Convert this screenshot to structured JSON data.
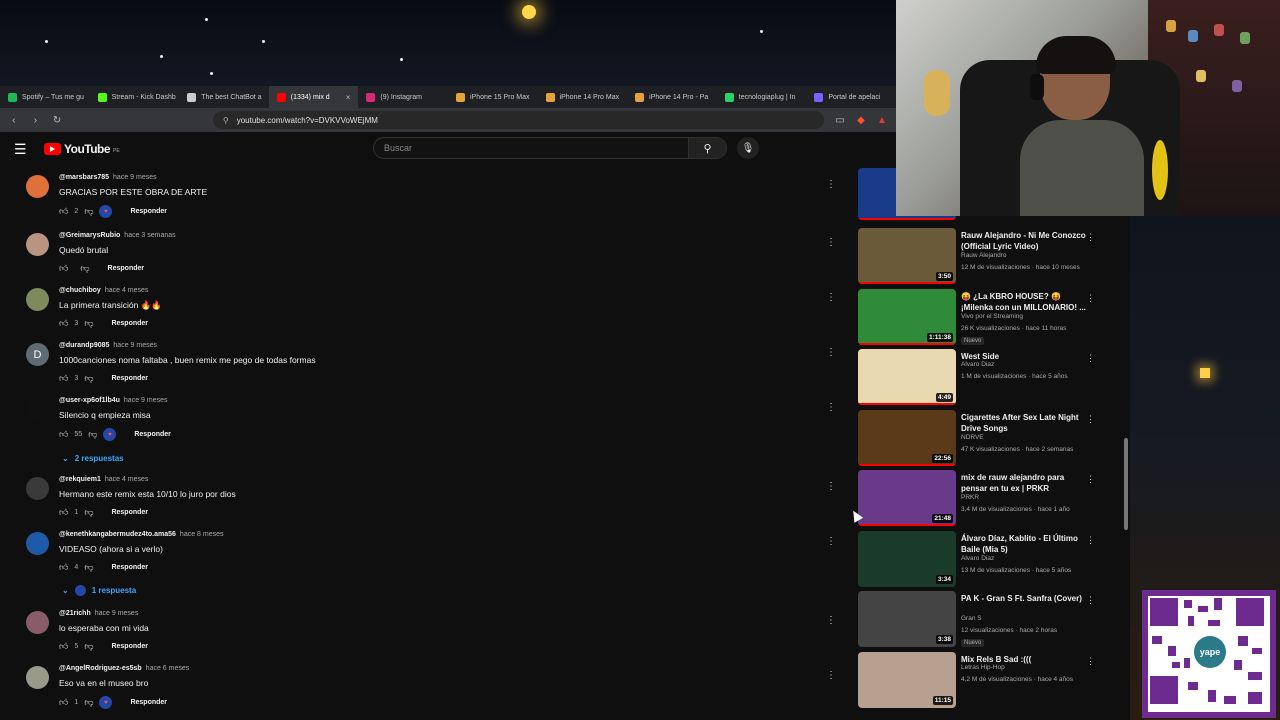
{
  "browser": {
    "tabs": [
      {
        "label": "Spotify – Tus me gu",
        "color": "#1db954"
      },
      {
        "label": "Stream - Kick Dashb",
        "color": "#53fc18"
      },
      {
        "label": "The best ChatBot a",
        "color": "#cccccc"
      },
      {
        "label": "(1334) mix d",
        "color": "#ff0000"
      },
      {
        "label": "(9) Instagram",
        "color": "#d62976"
      },
      {
        "label": "iPhone 15 Pro Max",
        "color": "#e8a23a"
      },
      {
        "label": "iPhone 14 Pro Max",
        "color": "#e8a23a"
      },
      {
        "label": "iPhone 14 Pro - Pa",
        "color": "#e8a23a"
      },
      {
        "label": "tecnologiaplug | In",
        "color": "#25d366"
      },
      {
        "label": "Portal de apelaci",
        "color": "#7b61ff"
      }
    ],
    "url": "youtube.com/watch?v=DVKVVoWEjMM"
  },
  "youtube": {
    "logo": "YouTube",
    "region": "PE",
    "search_placeholder": "Buscar"
  },
  "comments": [
    {
      "user": "@marsbars785",
      "time": "hace 9 meses",
      "text": "GRACIAS POR ESTE OBRA DE ARTE",
      "likes": "2",
      "heart": true,
      "avatar_color": "#e0703a",
      "avatar_letter": ""
    },
    {
      "user": "@GreimarysRubio",
      "time": "hace 3 semanas",
      "text": "Quedó brutal",
      "likes": "",
      "heart": false,
      "avatar_color": "#b99483",
      "avatar_letter": ""
    },
    {
      "user": "@chuchiboy",
      "time": "hace 4 meses",
      "text": "La primera transición 🔥🔥",
      "likes": "3",
      "heart": false,
      "avatar_color": "#7d8a5e",
      "avatar_letter": ""
    },
    {
      "user": "@durandp9085",
      "time": "hace 9 meses",
      "text": "1000canciones noma faltaba , buen remix me pego de todas formas",
      "likes": "3",
      "heart": false,
      "avatar_color": "#5f6a72",
      "avatar_letter": "D"
    },
    {
      "user": "@user-xp6of1lb4u",
      "time": "hace 9 meses",
      "text": "Silencio q empieza misa",
      "likes": "55",
      "heart": true,
      "avatar_color": "#101010",
      "avatar_letter": ""
    },
    {
      "user": "@rekquiem1",
      "time": "hace 4 meses",
      "text": "Hermano este remix esta 10/10 lo juro por dios",
      "likes": "1",
      "heart": false,
      "avatar_color": "#3a3a3a",
      "avatar_letter": ""
    },
    {
      "user": "@kenethkangabermudez4to.ama56",
      "time": "hace 8 meses",
      "text": "VIDEASO (ahora si a verlo)",
      "likes": "4",
      "heart": false,
      "avatar_color": "#1e5aa8",
      "avatar_letter": ""
    },
    {
      "user": "@21richh",
      "time": "hace 9 meses",
      "text": "lo esperaba con mi vida",
      "likes": "5",
      "heart": false,
      "avatar_color": "#8a5c6a",
      "avatar_letter": ""
    },
    {
      "user": "@AngelRodriguez-es5sb",
      "time": "hace 6 meses",
      "text": "Eso va en el museo bro",
      "likes": "1",
      "heart": true,
      "avatar_color": "#9a9a8a",
      "avatar_letter": ""
    }
  ],
  "reply_label": "Responder",
  "reply_threads": [
    "2 respuestas",
    "1 respuesta"
  ],
  "recommendations": [
    {
      "title": "Rauw Alejandro - Ni Me Conozco (Official Lyric Video)",
      "channel": "Rauw Alejandro",
      "stats": "12 M de visualizaciones · hace 10 meses",
      "duration": "3:50",
      "badge": "",
      "thumb": "#6a5a3a"
    },
    {
      "title": "😝 ¿La KBRO HOUSE? 😝 ¡Milenka con un MILLONARIO! ...",
      "channel": "Vivo por el Streaming",
      "stats": "26 K visualizaciones · hace 11 horas",
      "duration": "1:11:38",
      "badge": "Nuevo",
      "thumb": "#2f8a3a"
    },
    {
      "title": "West Side",
      "channel": "Alvaro Diaz",
      "stats": "1 M de visualizaciones · hace 5 años",
      "duration": "4:49",
      "badge": "",
      "thumb": "#e8d9b0"
    },
    {
      "title": "Cigarettes After Sex Late Night Drive Songs",
      "channel": "NDRVE",
      "stats": "47 K visualizaciones · hace 2 semanas",
      "duration": "22:56",
      "badge": "",
      "thumb": "#5a3a18"
    },
    {
      "title": "mix de rauw alejandro para pensar en tu ex | PRKR",
      "channel": "PRKR",
      "stats": "3,4 M de visualizaciones · hace 1 año",
      "duration": "21:48",
      "badge": "",
      "thumb": "#6a3a8a"
    },
    {
      "title": "Álvaro Díaz, Kablito - El Último Baile (Mia 5)",
      "channel": "Alvaro Diaz",
      "stats": "13 M de visualizaciones · hace 5 años",
      "duration": "3:34",
      "badge": "",
      "thumb": "#1a3a2a"
    },
    {
      "title": "PA K - Gran S Ft. Sanfra (Cover)",
      "channel": "Gran S",
      "stats": "12 visualizaciones · hace 2 horas",
      "duration": "3:38",
      "badge": "Nuevo",
      "thumb": "#444444"
    },
    {
      "title": "Mix Rels B Sad :(((",
      "channel": "Letras Hip-Hop",
      "stats": "4,2 M de visualizaciones · hace 4 años",
      "duration": "11:15",
      "badge": "",
      "thumb": "#b8a090"
    }
  ],
  "qr_label": "yape"
}
